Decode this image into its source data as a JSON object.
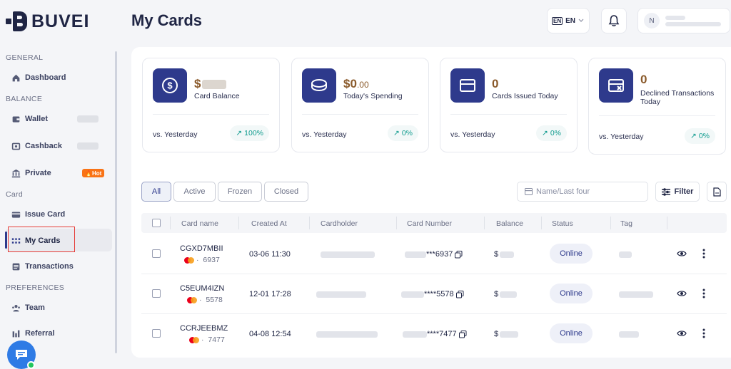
{
  "brand": {
    "name": "BUVEI"
  },
  "sidebar": {
    "sections": [
      "GENERAL",
      "BALANCE",
      "Card",
      "PREFERENCES"
    ],
    "items": [
      {
        "label": "Dashboard",
        "icon": "home-icon"
      },
      {
        "label": "Wallet",
        "icon": "wallet-icon"
      },
      {
        "label": "Cashback",
        "icon": "cashback-icon"
      },
      {
        "label": "Private",
        "icon": "bank-icon",
        "badge": "Hot"
      },
      {
        "label": "Issue Card",
        "icon": "card-icon"
      },
      {
        "label": "My Cards",
        "icon": "grid-icon",
        "active": true
      },
      {
        "label": "Transactions",
        "icon": "list-icon"
      },
      {
        "label": "Team",
        "icon": "team-icon"
      },
      {
        "label": "Referral",
        "icon": "referral-icon"
      }
    ]
  },
  "header": {
    "title": "My Cards",
    "language": {
      "flag": "EN",
      "code": "EN"
    },
    "user_initial": "N"
  },
  "stats": [
    {
      "value_prefix": "$",
      "value": "",
      "label": "Card Balance",
      "vs": "vs. Yesterday",
      "trend": "100%"
    },
    {
      "value_prefix": "$",
      "value": "0",
      "value_decimals": ".00",
      "label": "Today's Spending",
      "vs": "vs. Yesterday",
      "trend": "0%"
    },
    {
      "value_prefix": "",
      "value": "0",
      "label": "Cards Issued Today",
      "vs": "vs. Yesterday",
      "trend": "0%"
    },
    {
      "value_prefix": "",
      "value": "0",
      "label": "Declined Transactions Today",
      "vs": "vs. Yesterday",
      "trend": "0%"
    }
  ],
  "filters": {
    "tabs": [
      "All",
      "Active",
      "Frozen",
      "Closed"
    ],
    "active_tab": "All",
    "search_placeholder": "Name/Last four",
    "filter_label": "Filter"
  },
  "table": {
    "columns": [
      "Card name",
      "Created At",
      "Cardholder",
      "Card Number",
      "Balance",
      "Status",
      "Tag"
    ],
    "rows": [
      {
        "name": "CGXD7MBII",
        "last4": "6937",
        "created": "03-06 11:30",
        "number_suffix": "***6937",
        "balance_prefix": "$",
        "status": "Online"
      },
      {
        "name": "C5EUM4IZN",
        "last4": "5578",
        "created": "12-01 17:28",
        "number_suffix": "****5578",
        "balance_prefix": "$",
        "status": "Online"
      },
      {
        "name": "CCRJEEBMZ",
        "last4": "7477",
        "created": "04-08 12:54",
        "number_suffix": "****7477",
        "balance_prefix": "$",
        "status": "Online"
      }
    ]
  },
  "colors": {
    "primary": "#2e3a8c",
    "accent_value": "#8a5a2b",
    "trend": "#0f9b8e",
    "hot_badge": "#f97316"
  }
}
